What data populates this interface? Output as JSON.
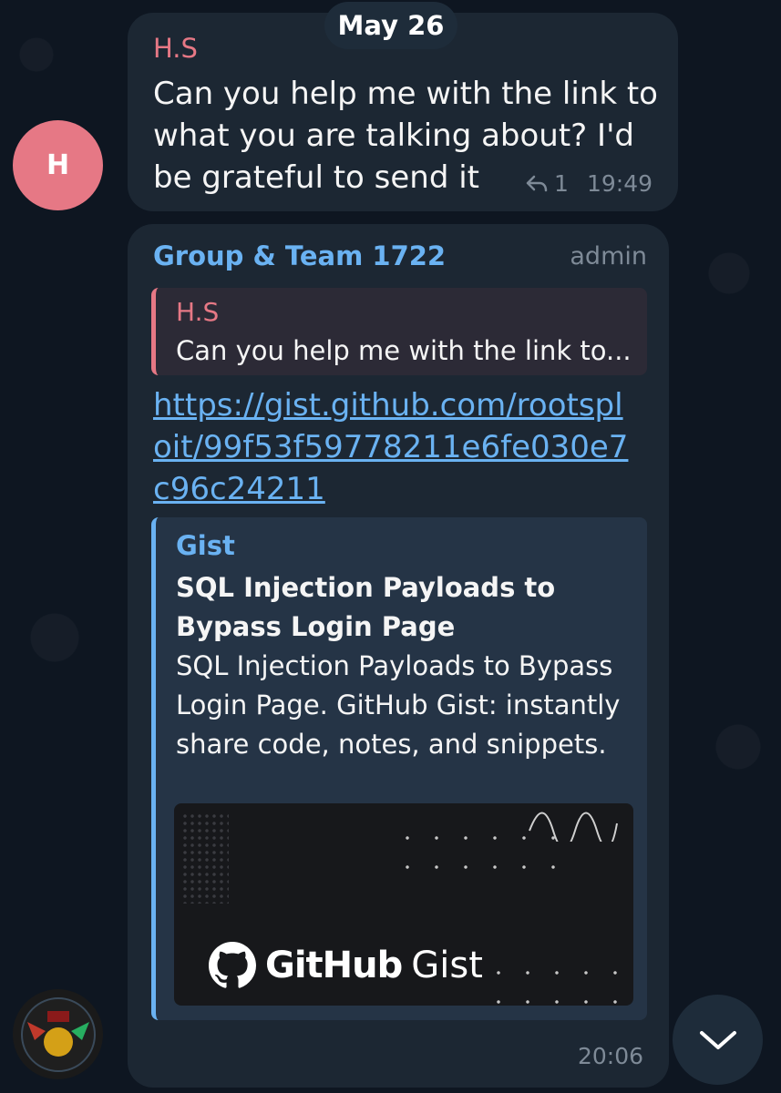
{
  "date_separator": "May 26",
  "message1": {
    "avatar_letter": "H",
    "sender": "H.S",
    "text": "Can you help me with the link to what you are talking about? I'd be grateful to send it",
    "reply_count": "1",
    "time": "19:49"
  },
  "message2": {
    "sender": "Group & Team 1722",
    "role": "admin",
    "quote": {
      "name": "H.S",
      "text": "Can you help me with the link to..."
    },
    "link": "https://gist.github.com/rootsploit/99f53f59778211e6fe030e7c96c24211",
    "preview": {
      "site": "Gist",
      "title": "SQL Injection Payloads to Bypass Login Page",
      "description": "SQL Injection Payloads to Bypass Login Page. GitHub Gist: instantly share code, notes, and snippets.",
      "image_brand_bold": "GitHub",
      "image_brand_light": "Gist"
    },
    "time": "20:06"
  },
  "icons": {
    "reply": "reply-arrow-icon",
    "scroll_down": "chevron-down-icon",
    "github": "github-octocat-icon"
  },
  "colors": {
    "background": "#0e1621",
    "bubble": "#1c2733",
    "accent_blue": "#6ab2f2",
    "accent_pink": "#e67885"
  }
}
